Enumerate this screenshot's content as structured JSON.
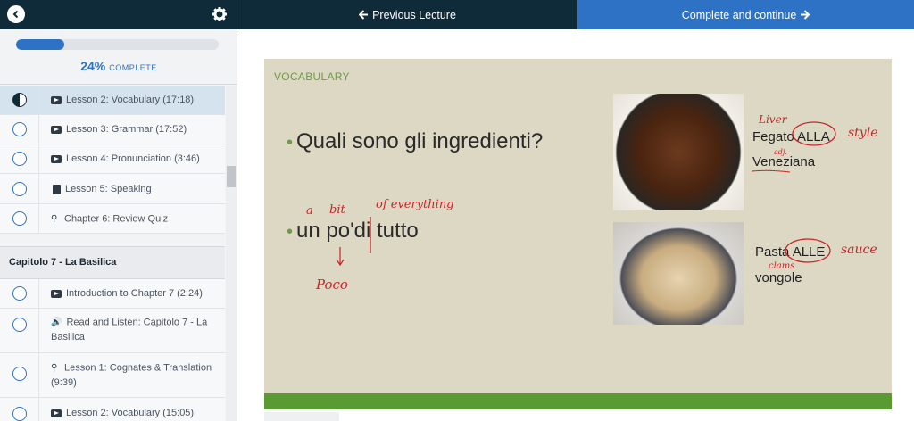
{
  "sidebar": {
    "progress_percent": "24%",
    "progress_word": "COMPLETE",
    "progress_fraction": 0.24,
    "items_top": [
      {
        "icon": "play-icon",
        "label": "Lesson 2: Vocabulary (17:18)",
        "status": "partial"
      },
      {
        "icon": "play-icon",
        "label": "Lesson 3: Grammar (17:52)",
        "status": "empty"
      },
      {
        "icon": "play-icon",
        "label": "Lesson 4: Pronunciation (3:46)",
        "status": "empty"
      },
      {
        "icon": "document-icon",
        "label": "Lesson 5: Speaking",
        "status": "empty"
      },
      {
        "icon": "lightbulb-icon",
        "label": "Chapter 6: Review Quiz",
        "status": "empty"
      }
    ],
    "section_title": "Capitolo 7 - La Basilica",
    "items_bottom": [
      {
        "icon": "play-icon",
        "label": "Introduction to Chapter 7 (2:24)"
      },
      {
        "icon": "speaker-icon",
        "label": "Read and Listen: Capitolo 7 - La Basilica"
      },
      {
        "icon": "lightbulb-icon",
        "label": "Lesson 1: Cognates & Translation (9:39)"
      },
      {
        "icon": "play-icon",
        "label": "Lesson 2: Vocabulary (15:05)"
      }
    ]
  },
  "nav": {
    "previous_label": "Previous Lecture",
    "next_label": "Complete and continue"
  },
  "slide": {
    "label": "VOCABULARY",
    "bullet1": "Quali sono gli ingredienti?",
    "bullet2": "un po'di tutto",
    "food1_line1": "Fegato ALLA",
    "food1_line2": "Veneziana",
    "food2_line1": "Pasta ALLE",
    "food2_line2": "vongole",
    "annotations": {
      "a": "a",
      "bit": "bit",
      "of_everything": "of everything",
      "poco": "Poco",
      "liver": "Liver",
      "style1": "style",
      "adj": "adj.",
      "sauce": "sauce",
      "clams": "clams"
    }
  },
  "colors": {
    "navy": "#0f2a39",
    "blue": "#2d72c4",
    "green": "#5a9a32"
  }
}
